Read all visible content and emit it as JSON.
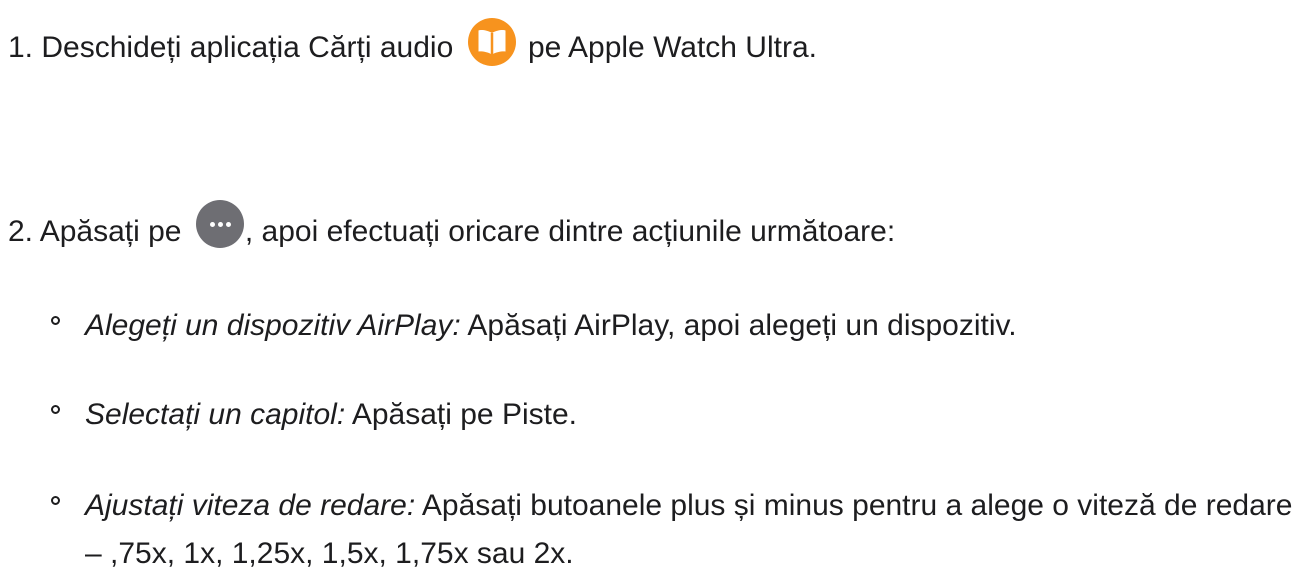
{
  "steps": [
    {
      "number": "1.",
      "text_before_icon": "Deschideți aplicația Cărți audio",
      "icon": "books-app-icon",
      "text_after_icon": "pe Apple Watch Ultra."
    },
    {
      "number": "2.",
      "text_before_icon": "Apăsați pe",
      "icon": "more-options-icon",
      "text_after_icon": ", apoi efectuați oricare dintre acțiunile următoare:"
    }
  ],
  "actions": [
    {
      "term": "Alegeți un dispozitiv AirPlay:",
      "description": "Apăsați AirPlay, apoi alegeți un dispozitiv."
    },
    {
      "term": "Selectați un capitol:",
      "description": "Apăsați pe Piste."
    },
    {
      "term": "Ajustați viteza de redare:",
      "description": "Apăsați butoanele plus și minus pentru a alege o viteză de redare – ,75x, 1x, 1,25x, 1,5x, 1,75x sau 2x."
    }
  ],
  "colors": {
    "text": "#1d1d1f",
    "books_icon": "#f7931e",
    "more_icon": "#6e6e73"
  }
}
